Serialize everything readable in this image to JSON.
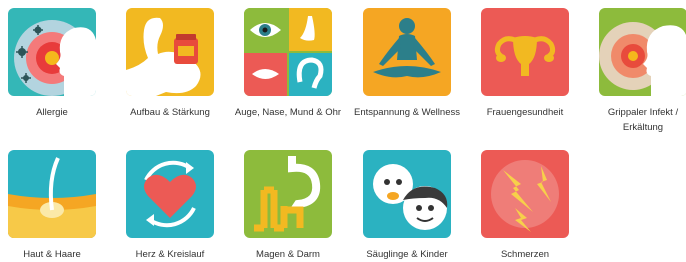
{
  "categories": [
    {
      "label": "Allergie",
      "icon": "allergy-icon",
      "bg": "#34b7b7"
    },
    {
      "label": "Aufbau & Stärkung",
      "icon": "strength-icon",
      "bg": "#f2b921"
    },
    {
      "label": "Auge, Nase, Mund & Ohr",
      "icon": "eye-nose-mouth-ear-icon",
      "bg": "#8dbb3c"
    },
    {
      "label": "Entspannung & Wellness",
      "icon": "meditation-icon",
      "bg": "#f5a623"
    },
    {
      "label": "Frauengesundheit",
      "icon": "uterus-icon",
      "bg": "#ec5a55"
    },
    {
      "label": "Grippaler Infekt / Erkältung",
      "icon": "cold-flu-icon",
      "bg": "#8dbb3c"
    },
    {
      "label": "Haut & Haare",
      "icon": "skin-hair-icon",
      "bg": "#2bb2c1"
    },
    {
      "label": "Herz & Kreislauf",
      "icon": "heart-circulation-icon",
      "bg": "#2bb2c1"
    },
    {
      "label": "Magen & Darm",
      "icon": "stomach-intestine-icon",
      "bg": "#8dbb3c"
    },
    {
      "label": "Säuglinge & Kinder",
      "icon": "baby-child-icon",
      "bg": "#2bb2c1"
    },
    {
      "label": "Schmerzen",
      "icon": "pain-icon",
      "bg": "#ec5a55"
    }
  ]
}
